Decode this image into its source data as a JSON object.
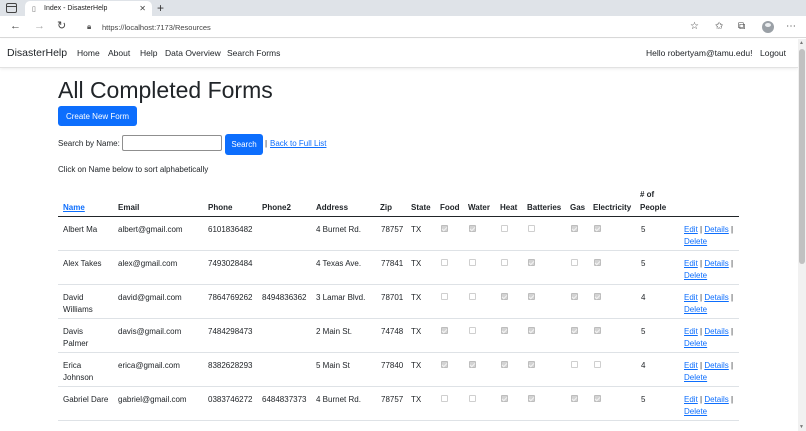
{
  "browser": {
    "tab_title": "Index - DisasterHelp",
    "url": "https://localhost:7173/Resources",
    "icons": [
      "window-icon",
      "back-icon",
      "forward-icon",
      "refresh-icon",
      "lock-icon",
      "favorites-add-icon",
      "favorites-icon",
      "collections-icon",
      "profile-icon",
      "menu-icon"
    ]
  },
  "navbar": {
    "brand": "DisasterHelp",
    "links": [
      "Home",
      "About",
      "Help",
      "Data Overview",
      "Search Forms"
    ],
    "greeting": "Hello robertyam@tamu.edu!",
    "logout": "Logout"
  },
  "page": {
    "title": "All Completed Forms",
    "create_button": "Create New Form",
    "search_label": "Search by Name:",
    "search_value": "",
    "search_button": "Search",
    "separator": "|",
    "back_link": "Back to Full List",
    "sort_hint": "Click on Name below to sort alphabetically"
  },
  "table": {
    "headers": [
      "Name",
      "Email",
      "Phone",
      "Phone2",
      "Address",
      "Zip",
      "State",
      "Food",
      "Water",
      "Heat",
      "Batteries",
      "Gas",
      "Electricity",
      "# of People"
    ],
    "people_header_line1": "# of",
    "people_header_line2": "People",
    "rows": [
      {
        "name1": "Albert Ma",
        "name2": "",
        "email": "albert@gmail.com",
        "phone": "6101836482",
        "phone2": "",
        "address": "4 Burnet Rd.",
        "zip": "78757",
        "state": "TX",
        "checks": [
          true,
          true,
          false,
          false,
          true,
          true
        ],
        "people": "5"
      },
      {
        "name1": "Alex Takes",
        "name2": "",
        "email": "alex@gmail.com",
        "phone": "7493028484",
        "phone2": "",
        "address": "4 Texas Ave.",
        "zip": "77841",
        "state": "TX",
        "checks": [
          false,
          false,
          false,
          true,
          false,
          true
        ],
        "people": "5"
      },
      {
        "name1": "David",
        "name2": "Williams",
        "email": "david@gmail.com",
        "phone": "7864769262",
        "phone2": "8494836362",
        "address": "3 Lamar Blvd.",
        "zip": "78701",
        "state": "TX",
        "checks": [
          false,
          false,
          true,
          true,
          true,
          true
        ],
        "people": "4"
      },
      {
        "name1": "Davis",
        "name2": "Palmer",
        "email": "davis@gmail.com",
        "phone": "7484298473",
        "phone2": "",
        "address": "2 Main St.",
        "zip": "74748",
        "state": "TX",
        "checks": [
          true,
          false,
          true,
          true,
          true,
          true
        ],
        "people": "5"
      },
      {
        "name1": "Erica",
        "name2": "Johnson",
        "email": "erica@gmail.com",
        "phone": "8382628293",
        "phone2": "",
        "address": "5 Main St",
        "zip": "77840",
        "state": "TX",
        "checks": [
          true,
          true,
          true,
          true,
          false,
          false
        ],
        "people": "4"
      },
      {
        "name1": "Gabriel Dare",
        "name2": "",
        "email": "gabriel@gmail.com",
        "phone": "0383746272",
        "phone2": "6484837373",
        "address": "4 Burnet Rd.",
        "zip": "78757",
        "state": "TX",
        "checks": [
          false,
          false,
          true,
          true,
          true,
          true
        ],
        "people": "5"
      }
    ],
    "edit_label": "Edit",
    "details_label": "Details",
    "delete_label": "Delete",
    "action_sep": "|"
  }
}
